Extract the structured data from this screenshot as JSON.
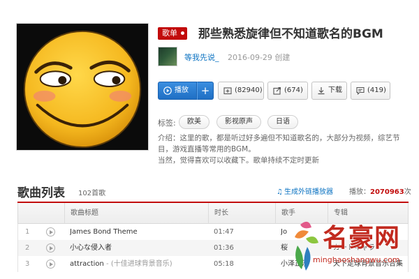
{
  "playlist": {
    "badge": "歌单",
    "title": "那些熟悉旋律但不知道歌名的BGM",
    "creator": "等我先说_",
    "created": "2016-09-29 创建"
  },
  "actions": {
    "play": "播放",
    "add": "+",
    "favorite": "(82940)",
    "share": "(674)",
    "download": "下载",
    "comment": "(419)"
  },
  "tags": {
    "label": "标签:",
    "items": [
      "欧美",
      "影视原声",
      "日语"
    ]
  },
  "description": {
    "lines": [
      "介绍：这里的歌，都是听过好多遍但不知道歌名的，大部分为视频，综艺节",
      "目，游戏直播等常用的BGM。",
      "当然，觉得喜欢可以收藏下。歌单持续不定时更新"
    ]
  },
  "songlist": {
    "title": "歌曲列表",
    "count": "102首歌",
    "external_player": "生成外链播放器",
    "plays_label": "播放：",
    "plays_value": "2070963",
    "plays_unit": "次",
    "columns": [
      "歌曲标题",
      "时长",
      "歌手",
      "专辑"
    ],
    "rows": [
      {
        "index": "1",
        "title": "James Bond Theme",
        "subtitle": "",
        "duration": "01:47",
        "artist": "Jo",
        "album": ""
      },
      {
        "index": "2",
        "title": "小心な侵入者",
        "subtitle": "",
        "duration": "01:36",
        "artist": "桜",
        "album": "カートキャラ"
      },
      {
        "index": "3",
        "title": "attraction",
        "subtitle": " - (十佳进球背景音乐)",
        "duration": "05:18",
        "artist": "小泽正澄",
        "album": "天下足球背景音乐合集"
      }
    ]
  },
  "watermark": {
    "text": "名豪网",
    "url": "minghaoshangwu.com"
  },
  "colors": {
    "accent": "#c20c0c",
    "link": "#0c73c2",
    "play_button": "#1f6fc4"
  }
}
